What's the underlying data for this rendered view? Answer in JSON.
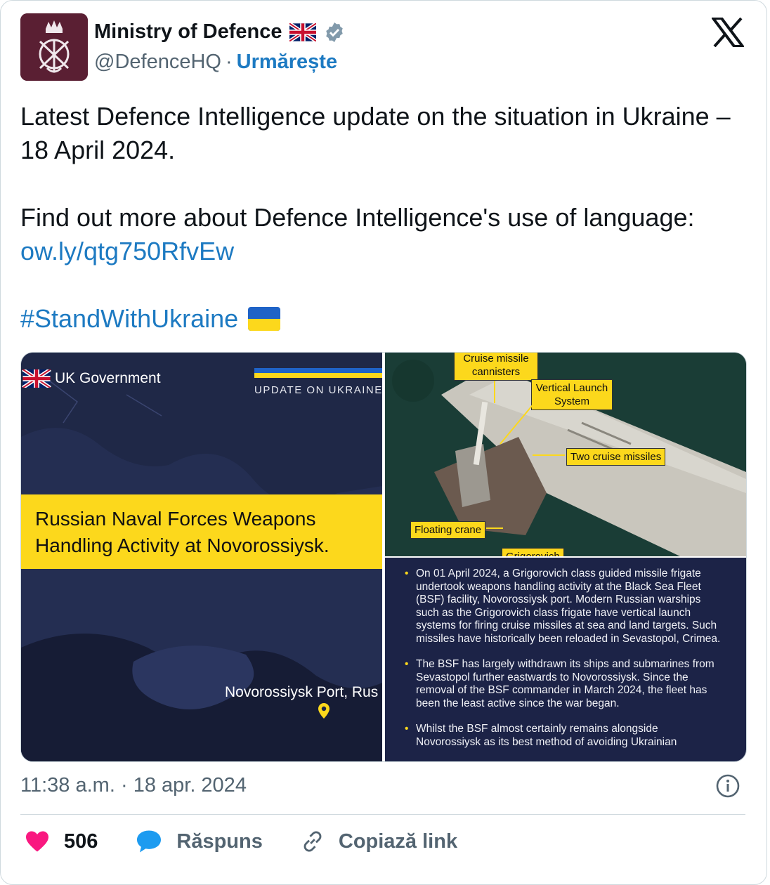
{
  "author": {
    "display_name": "Ministry of Defence",
    "handle": "@DefenceHQ",
    "separator": "·",
    "follow_label": "Urmărește",
    "verified": true
  },
  "tweet": {
    "line1": "Latest Defence Intelligence update on the situation in Ukraine – 18 April 2024.",
    "line2_prefix": "Find out more about Defence Intelligence's use of language: ",
    "link_text": "ow.ly/qtg750RfvEw",
    "hashtag": "#StandWithUkraine"
  },
  "media": {
    "left": {
      "org": "UK Government",
      "label": "UPDATE ON UKRAINE",
      "title_line1": "Russian Naval Forces Weapons",
      "title_line2": "Handling Activity at Novorossiysk.",
      "map_label": "Novorossiysk Port, Rus"
    },
    "top_right": {
      "tag_cannisters_1": "Cruise missile",
      "tag_cannisters_2": "cannisters",
      "tag_vls_1": "Vertical Launch",
      "tag_vls_2": "System",
      "tag_missiles": "Two cruise missiles",
      "tag_crane": "Floating crane",
      "tag_grig": "Grigorovich"
    },
    "bottom_right": {
      "bullets": [
        "On 01 April 2024, a Grigorovich class guided missile frigate undertook weapons handling activity at the Black Sea Fleet (BSF) facility, Novorossiysk port. Modern Russian warships such as the Grigorovich class frigate have vertical launch systems for firing cruise missiles at sea and land targets. Such missiles have historically been reloaded in Sevastopol, Crimea.",
        "The BSF has largely withdrawn its ships and submarines from Sevastopol further eastwards to Novorossiysk. Since the removal of the BSF commander in March 2024, the fleet has been the least active since the war began.",
        "Whilst the BSF almost certainly remains alongside Novorossiysk as its best method of avoiding Ukrainian"
      ]
    }
  },
  "timestamp": {
    "time": "11:38 a.m.",
    "separator": "·",
    "date": "18 apr. 2024"
  },
  "actions": {
    "like_count": "506",
    "reply_label": "Răspuns",
    "copy_label": "Copiază link"
  },
  "colors": {
    "link": "#1d7ac2",
    "like": "#f91880",
    "reply_icon": "#1d9bf0",
    "banner_yellow": "#fcd81c"
  }
}
